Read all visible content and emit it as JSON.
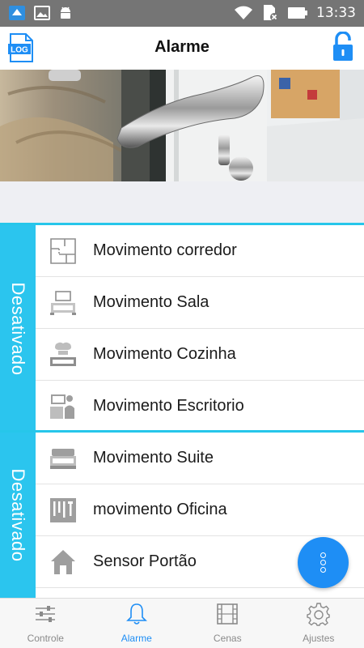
{
  "status_bar": {
    "time": "13:33",
    "icons": [
      "app-notification-icon",
      "image-icon",
      "android-icon",
      "wifi-icon",
      "sd-card-icon",
      "battery-icon"
    ]
  },
  "header": {
    "title": "Alarme",
    "log_icon_text": "LOG",
    "right_icon": "unlocked-padlock-icon"
  },
  "zones": [
    {
      "status": "Desativado",
      "items": [
        {
          "label": "Movimento corredor",
          "icon": "floor-plan-icon"
        },
        {
          "label": "Movimento Sala",
          "icon": "living-room-icon"
        },
        {
          "label": "Movimento Cozinha",
          "icon": "kitchen-icon"
        },
        {
          "label": "Movimento Escritorio",
          "icon": "office-icon"
        }
      ]
    },
    {
      "status": "Desativado",
      "items": [
        {
          "label": "Movimento Suite",
          "icon": "bed-icon"
        },
        {
          "label": "movimento Oficina",
          "icon": "tools-icon"
        },
        {
          "label": "Sensor Portão",
          "icon": "house-icon"
        }
      ]
    }
  ],
  "fab": {
    "icon": "more-vertical-icon"
  },
  "bottom_nav": {
    "tabs": [
      {
        "label": "Controle",
        "icon": "sliders-icon",
        "active": false
      },
      {
        "label": "Alarme",
        "icon": "bell-icon",
        "active": true
      },
      {
        "label": "Cenas",
        "icon": "film-icon",
        "active": false
      },
      {
        "label": "Ajustes",
        "icon": "gear-icon",
        "active": false
      }
    ]
  },
  "colors": {
    "accent": "#2bc5ee",
    "primary": "#1e8ef5",
    "status_bar": "#757575",
    "list_icon": "#8e8e8e"
  }
}
